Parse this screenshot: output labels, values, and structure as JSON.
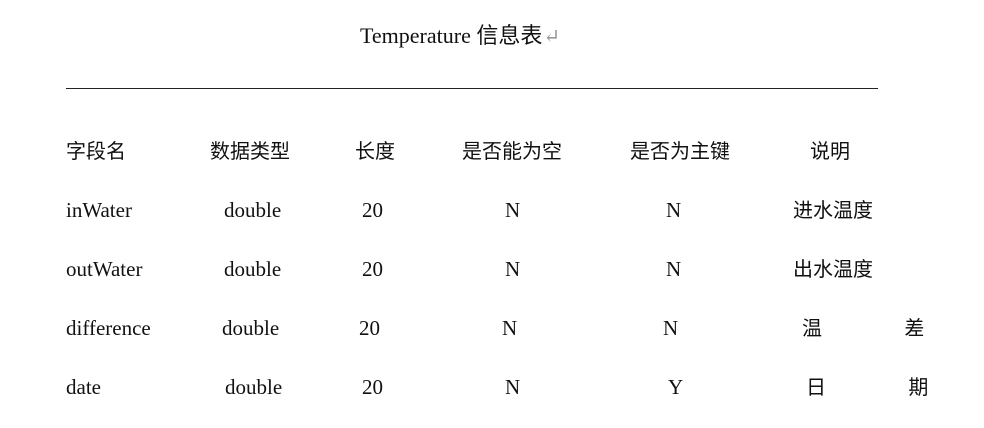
{
  "document": {
    "title_text": "Temperature  信息表",
    "title_mark": "↵"
  },
  "table": {
    "headers": [
      "字段名",
      "数据类型",
      "长度",
      "是否能为空",
      "是否为主键",
      "说明"
    ],
    "rows": [
      [
        "inWater",
        "double",
        "20",
        "N",
        "N",
        "进水温度"
      ],
      [
        "outWater",
        "double",
        "20",
        "N",
        "N",
        "出水温度"
      ],
      [
        "difference",
        "double",
        "20",
        "N",
        "N",
        "温 差"
      ],
      [
        "date",
        "double",
        "20",
        "N",
        "Y",
        "日 期"
      ]
    ]
  }
}
